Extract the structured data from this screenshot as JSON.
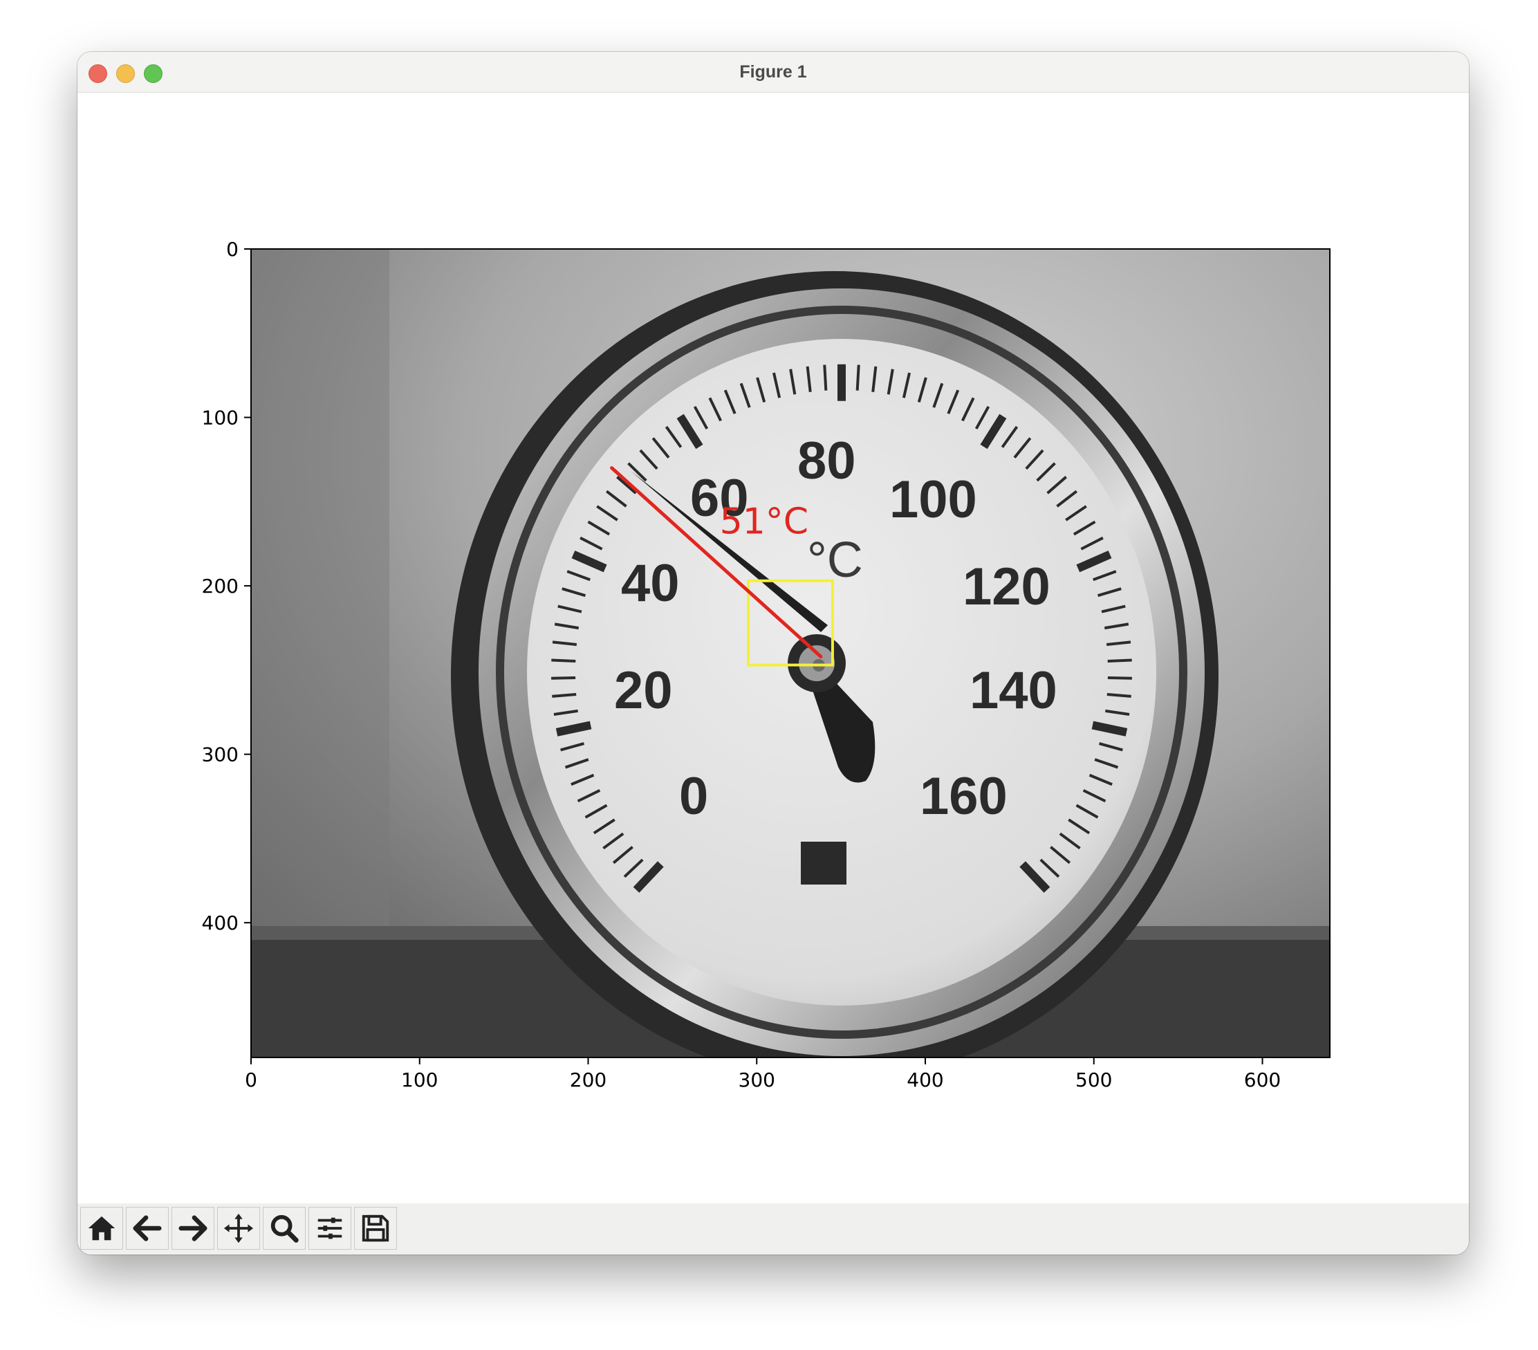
{
  "window": {
    "title": "Figure 1"
  },
  "toolbar": {
    "buttons": [
      {
        "name": "home-button",
        "icon": "home-icon"
      },
      {
        "name": "back-button",
        "icon": "arrow-left-icon"
      },
      {
        "name": "forward-button",
        "icon": "arrow-right-icon"
      },
      {
        "name": "pan-button",
        "icon": "move-icon"
      },
      {
        "name": "zoom-button",
        "icon": "magnifier-icon"
      },
      {
        "name": "configure-subplots-button",
        "icon": "sliders-icon"
      },
      {
        "name": "save-button",
        "icon": "floppy-disk-icon"
      }
    ]
  },
  "chart_data": {
    "type": "image",
    "image_description": "grayscale photo of a round dial thermometer, scale 0 to 160 degrees C",
    "dial_labels": [
      "0",
      "20",
      "40",
      "60",
      "80",
      "100",
      "120",
      "140",
      "160",
      "°C"
    ],
    "xlim": [
      0,
      640
    ],
    "ylim": [
      480,
      0
    ],
    "x_ticks": [
      0,
      100,
      200,
      300,
      400,
      500,
      600
    ],
    "y_ticks": [
      0,
      100,
      200,
      300,
      400
    ],
    "x_tick_labels": [
      "0",
      "100",
      "200",
      "300",
      "400",
      "500",
      "600"
    ],
    "y_tick_labels": [
      "0",
      "100",
      "200",
      "300",
      "400"
    ],
    "needle_line": {
      "x": [
        214,
        338
      ],
      "y": [
        130,
        242
      ],
      "color": "#e0261f"
    },
    "center_box": {
      "x": [
        295,
        345
      ],
      "y": [
        197,
        247
      ],
      "color": "#f4ef3a"
    },
    "annotation": {
      "text": "51°C",
      "x": 278,
      "y": 169,
      "color": "#e0261f"
    },
    "colors": {
      "needle": "#e0261f",
      "box": "#f4ef3a"
    }
  }
}
